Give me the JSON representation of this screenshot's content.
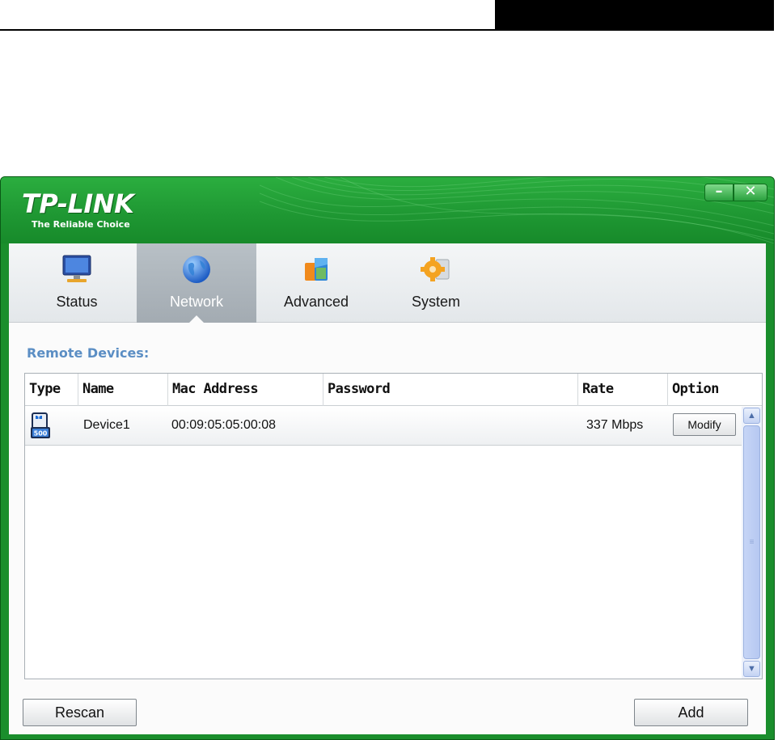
{
  "window": {
    "brand": "TP-LINK",
    "tagline": "The Reliable Choice",
    "minimize_label": "–",
    "close_label": "✕",
    "accent_color": "#1f9833"
  },
  "tabs": [
    {
      "label": "Status",
      "icon": "monitor-icon",
      "active": false
    },
    {
      "label": "Network",
      "icon": "globe-icon",
      "active": true
    },
    {
      "label": "Advanced",
      "icon": "advanced-icon",
      "active": false
    },
    {
      "label": "System",
      "icon": "gear-icon",
      "active": false
    }
  ],
  "remote_devices": {
    "title": "Remote Devices:",
    "columns": [
      "Type",
      "Name",
      "Mac Address",
      "Password",
      "Rate",
      "Option"
    ],
    "rows": [
      {
        "type_icon": "powerline-adapter-icon",
        "name": "Device1",
        "mac": "00:09:05:05:00:08",
        "password": "",
        "rate": "337 Mbps",
        "option_label": "Modify"
      }
    ]
  },
  "buttons": {
    "rescan": "Rescan",
    "add": "Add"
  },
  "scrollbar": {
    "up_glyph": "▲",
    "down_glyph": "▼",
    "grip_glyph": "≡"
  }
}
